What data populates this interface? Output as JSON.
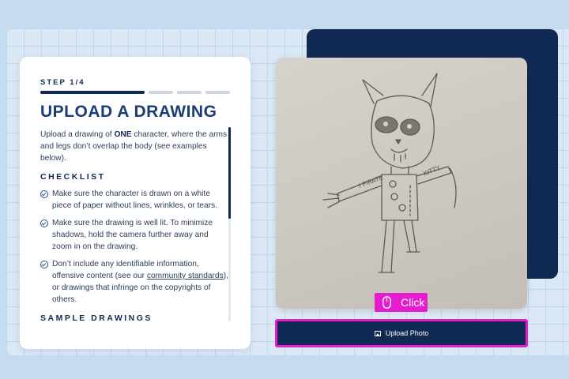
{
  "step": {
    "label": "STEP 1/4",
    "current": 1,
    "total": 4
  },
  "page": {
    "title": "UPLOAD A DRAWING"
  },
  "intro": {
    "before": "Upload a drawing of ",
    "bold": "ONE",
    "after": " character, where the arms and legs don’t overlap the body (see examples below)."
  },
  "checklist": {
    "heading": "CHECKLIST",
    "item1": "Make sure the character is drawn on a white piece of paper without lines, wrinkles, or tears.",
    "item2": "Make sure the drawing is well lit. To minimize shadows, hold the camera further away and zoom in on the drawing.",
    "item3_before": "Don’t include any identifiable information, offensive content (see our ",
    "item3_link": "community standards",
    "item3_after": "), or drawings that infringe on the copyrights of others."
  },
  "samples": {
    "heading": "SAMPLE DRAWINGS"
  },
  "drawing": {
    "left_arm_text": "I PIRATE",
    "right_arm_text": "KITTY"
  },
  "upload": {
    "label": "Upload Photo",
    "icon": "photo-icon"
  },
  "annotation": {
    "label": "Click",
    "icon": "mouse-icon",
    "color": "#e61cd0"
  },
  "colors": {
    "navy": "#102a53",
    "title": "#1b3d73",
    "highlight": "#e61cd0",
    "background": "#c5dcf0"
  }
}
